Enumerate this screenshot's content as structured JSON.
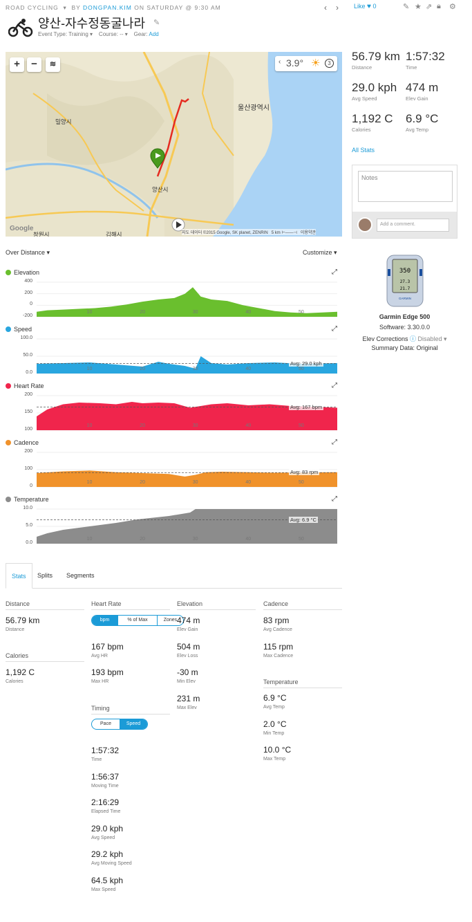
{
  "header": {
    "activity_type": "ROAD CYCLING",
    "by_label": "BY",
    "user": "DONGPAN.KIM",
    "when": "ON SATURDAY @ 9:30 AM",
    "title": "양산-자수정동굴나라",
    "event_type": "Event Type: Training ▾",
    "course": "Course: -- ▾",
    "gear_label": "Gear:",
    "gear_link": "Add",
    "like_label": "Like",
    "like_count": "0"
  },
  "map": {
    "weather_temp": "3.9°",
    "weather_wind": "3",
    "labels": {
      "ulsan": "울산광역시",
      "miryang": "밀양시",
      "yangsan": "양산시",
      "gimhae": "김해시",
      "changwon": "창원시"
    },
    "copyright": "지도 데이터 ©2015 Google, SK planet, ZENRIN",
    "scale": "5 km",
    "terms": "이용약관",
    "google": "Google"
  },
  "charts_toolbar": {
    "over": "Over Distance ▾",
    "customize": "Customize ▾"
  },
  "chart_data": [
    {
      "type": "area",
      "title": "Elevation",
      "color": "#6abf2e",
      "ylim": [
        -80,
        400
      ],
      "yticks": [
        400,
        200,
        0,
        -200
      ],
      "x": [
        0,
        2,
        5,
        8,
        11,
        14,
        17,
        20,
        23,
        26,
        28,
        29.5,
        31,
        33,
        36,
        39,
        42,
        45,
        48,
        51,
        54,
        56.79
      ],
      "y": [
        -10,
        10,
        20,
        30,
        40,
        60,
        90,
        130,
        160,
        180,
        240,
        330,
        200,
        160,
        140,
        80,
        40,
        0,
        -20,
        -30,
        -20,
        -10
      ]
    },
    {
      "type": "area",
      "title": "Speed",
      "color": "#29a6df",
      "ylim": [
        0,
        100
      ],
      "yticks": [
        "100.0",
        "50.0",
        "0.0"
      ],
      "avg_label": "Avg: 29.0 kph",
      "avg": 29.0,
      "x": [
        0,
        5,
        10,
        15,
        20,
        23,
        25,
        28,
        30,
        31,
        33,
        36,
        40,
        45,
        50,
        56.79
      ],
      "y": [
        28,
        30,
        32,
        26,
        20,
        34,
        28,
        22,
        14,
        50,
        30,
        26,
        30,
        32,
        28,
        30
      ]
    },
    {
      "type": "area",
      "title": "Heart Rate",
      "color": "#f0254c",
      "ylim": [
        100,
        200
      ],
      "yticks": [
        200,
        150,
        100
      ],
      "avg_label": "Avg: 167 bpm",
      "avg": 167,
      "x": [
        0,
        2,
        5,
        8,
        12,
        15,
        18,
        20,
        23,
        26,
        29,
        31,
        33,
        36,
        40,
        44,
        48,
        52,
        56.79
      ],
      "y": [
        140,
        160,
        175,
        180,
        178,
        175,
        182,
        178,
        180,
        178,
        165,
        170,
        175,
        178,
        172,
        175,
        170,
        168,
        165
      ]
    },
    {
      "type": "area",
      "title": "Cadence",
      "color": "#f0922b",
      "ylim": [
        0,
        200
      ],
      "yticks": [
        200,
        100,
        0
      ],
      "avg_label": "Avg: 83 rpm",
      "avg": 83,
      "x": [
        0,
        5,
        10,
        15,
        20,
        25,
        28,
        30,
        32,
        35,
        40,
        45,
        50,
        56.79
      ],
      "y": [
        80,
        90,
        95,
        85,
        80,
        75,
        60,
        70,
        85,
        88,
        85,
        82,
        84,
        85
      ]
    },
    {
      "type": "area",
      "title": "Temperature",
      "color": "#8c8c8c",
      "ylim": [
        0,
        10
      ],
      "yticks": [
        "10.0",
        "5.0",
        "0.0"
      ],
      "avg_label": "Avg: 6.9 °C",
      "avg": 6.9,
      "x": [
        0,
        2,
        5,
        10,
        15,
        19,
        25,
        29,
        30,
        45,
        50,
        56.79
      ],
      "y": [
        2,
        3,
        4,
        5,
        6,
        7,
        8,
        9,
        10,
        10,
        10,
        10
      ]
    }
  ],
  "xticks": [
    "10",
    "20",
    "30",
    "40",
    "50"
  ],
  "tabs": [
    "Stats",
    "Splits",
    "Segments"
  ],
  "stats": {
    "distance": {
      "header": "Distance",
      "value": "56.79 km",
      "label": "Distance"
    },
    "calories": {
      "header": "Calories",
      "value": "1,192 C",
      "label": "Calories"
    },
    "hr": {
      "header": "Heart Rate",
      "seg": [
        "bpm",
        "% of Max",
        "Zones"
      ],
      "items": [
        {
          "v": "167 bpm",
          "l": "Avg HR"
        },
        {
          "v": "193 bpm",
          "l": "Max HR"
        }
      ]
    },
    "timing": {
      "header": "Timing",
      "seg": [
        "Pace",
        "Speed"
      ],
      "items": [
        {
          "v": "1:57:32",
          "l": "Time"
        },
        {
          "v": "1:56:37",
          "l": "Moving Time"
        },
        {
          "v": "2:16:29",
          "l": "Elapsed Time"
        },
        {
          "v": "29.0 kph",
          "l": "Avg Speed"
        },
        {
          "v": "29.2 kph",
          "l": "Avg Moving Speed"
        },
        {
          "v": "64.5 kph",
          "l": "Max Speed"
        }
      ]
    },
    "elevation": {
      "header": "Elevation",
      "items": [
        {
          "v": "474 m",
          "l": "Elev Gain"
        },
        {
          "v": "504 m",
          "l": "Elev Loss"
        },
        {
          "v": "-30 m",
          "l": "Min Elev"
        },
        {
          "v": "231 m",
          "l": "Max Elev"
        }
      ]
    },
    "cadence": {
      "header": "Cadence",
      "items": [
        {
          "v": "83 rpm",
          "l": "Avg Cadence"
        },
        {
          "v": "115 rpm",
          "l": "Max Cadence"
        }
      ]
    },
    "temperature": {
      "header": "Temperature",
      "items": [
        {
          "v": "6.9 °C",
          "l": "Avg Temp"
        },
        {
          "v": "2.0 °C",
          "l": "Min Temp"
        },
        {
          "v": "10.0 °C",
          "l": "Max Temp"
        }
      ]
    }
  },
  "summary": [
    {
      "v": "56.79 km",
      "l": "Distance"
    },
    {
      "v": "1:57:32",
      "l": "Time"
    },
    {
      "v": "29.0 kph",
      "l": "Avg Speed"
    },
    {
      "v": "474 m",
      "l": "Elev Gain"
    },
    {
      "v": "1,192 C",
      "l": "Calories"
    },
    {
      "v": "6.9 °C",
      "l": "Avg Temp"
    }
  ],
  "all_stats": "All Stats",
  "notes": {
    "placeholder": "Notes",
    "comment_placeholder": "Add a comment."
  },
  "device": {
    "screen_speed": "350",
    "screen_a": "27.3",
    "screen_b": "21.7",
    "brand": "GARMIN",
    "name": "Garmin Edge 500",
    "software": "Software: 3.30.0.0",
    "elev_label": "Elev Corrections",
    "elev_value": "Disabled ▾",
    "summary": "Summary Data: Original"
  }
}
